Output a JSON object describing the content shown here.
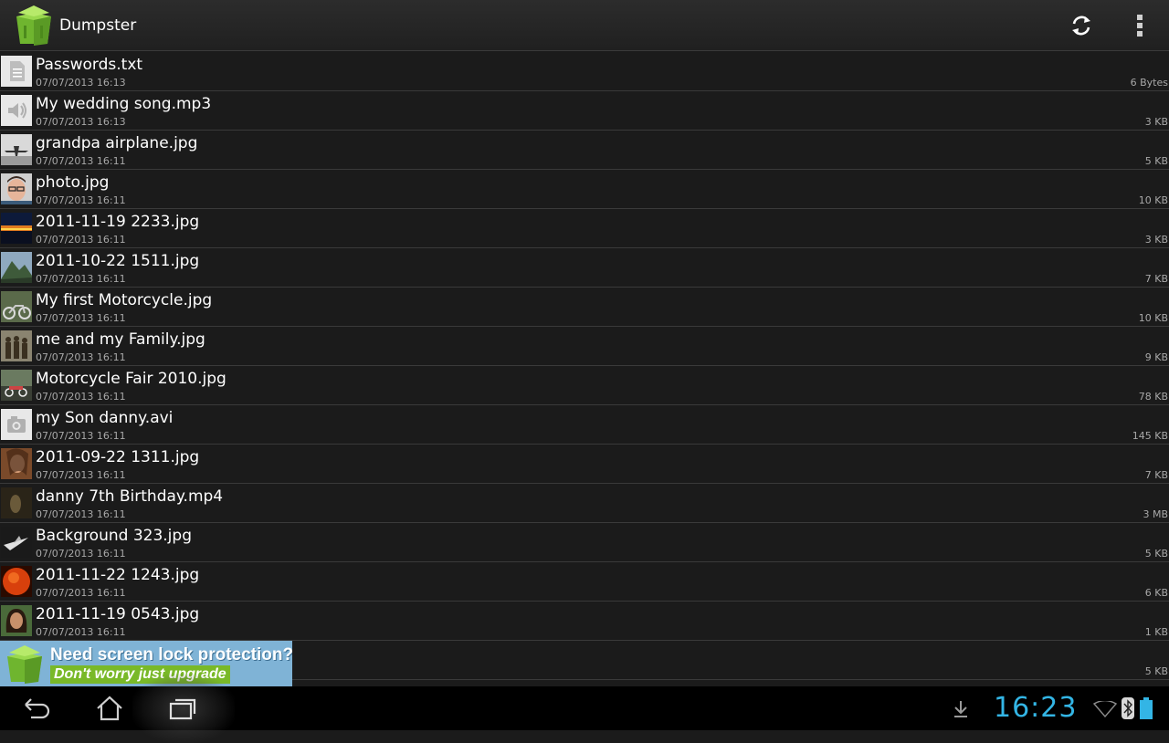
{
  "app": {
    "title": "Dumpster"
  },
  "actions": {
    "refresh_icon": "refresh-icon",
    "overflow_icon": "overflow-menu-icon"
  },
  "files": [
    {
      "name": "Passwords.txt",
      "date": "07/07/2013 16:13",
      "size": "6 Bytes",
      "thumb": "doc"
    },
    {
      "name": "My wedding song.mp3",
      "date": "07/07/2013 16:13",
      "size": "3 KB",
      "thumb": "audio"
    },
    {
      "name": "grandpa airplane.jpg",
      "date": "07/07/2013 16:11",
      "size": "5 KB",
      "thumb": "airplane"
    },
    {
      "name": "photo.jpg",
      "date": "07/07/2013 16:11",
      "size": "10 KB",
      "thumb": "face"
    },
    {
      "name": "2011-11-19 2233.jpg",
      "date": "07/07/2013 16:11",
      "size": "3 KB",
      "thumb": "sunset"
    },
    {
      "name": "2011-10-22 1511.jpg",
      "date": "07/07/2013 16:11",
      "size": "7 KB",
      "thumb": "mountain"
    },
    {
      "name": "My first Motorcycle.jpg",
      "date": "07/07/2013 16:11",
      "size": "10 KB",
      "thumb": "moto"
    },
    {
      "name": "me and my Family.jpg",
      "date": "07/07/2013 16:11",
      "size": "9 KB",
      "thumb": "family"
    },
    {
      "name": "Motorcycle Fair 2010.jpg",
      "date": "07/07/2013 16:11",
      "size": "78 KB",
      "thumb": "fair"
    },
    {
      "name": "my Son danny.avi",
      "date": "07/07/2013 16:11",
      "size": "145 KB",
      "thumb": "video"
    },
    {
      "name": "2011-09-22 1311.jpg",
      "date": "07/07/2013 16:11",
      "size": "7 KB",
      "thumb": "portrait"
    },
    {
      "name": "danny 7th Birthday.mp4",
      "date": "07/07/2013 16:11",
      "size": "3 MB",
      "thumb": "dark"
    },
    {
      "name": "Background  323.jpg",
      "date": "07/07/2013 16:11",
      "size": "5 KB",
      "thumb": "jet"
    },
    {
      "name": "2011-11-22 1243.jpg",
      "date": "07/07/2013 16:11",
      "size": "6 KB",
      "thumb": "sun"
    },
    {
      "name": "2011-11-19 0543.jpg",
      "date": "07/07/2013 16:11",
      "size": "1 KB",
      "thumb": "hippie"
    },
    {
      "name": "",
      "date": "",
      "size": "5 KB",
      "thumb": "hidden"
    }
  ],
  "ad": {
    "line1": "Need screen lock protection?",
    "line2": "Don't worry just upgrade"
  },
  "status": {
    "time": "16:23"
  },
  "colors": {
    "accent": "#33b5e5",
    "ad_bg": "#7fb3d6",
    "ad_green": "#79b928",
    "logo_green": "#7cc242"
  }
}
